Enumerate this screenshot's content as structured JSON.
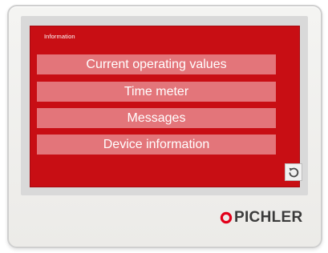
{
  "screen": {
    "title": "Information"
  },
  "menu": {
    "items": [
      {
        "label": "Current operating values"
      },
      {
        "label": "Time meter"
      },
      {
        "label": "Messages"
      },
      {
        "label": "Device information"
      }
    ]
  },
  "back_button": {
    "icon": "back-icon"
  },
  "brand": {
    "name": "PICHLER",
    "mark_color": "#e2001a"
  },
  "colors": {
    "screen_background": "#c80e14",
    "menu_button_background": "#e3757a",
    "menu_button_text": "#ffffff"
  }
}
